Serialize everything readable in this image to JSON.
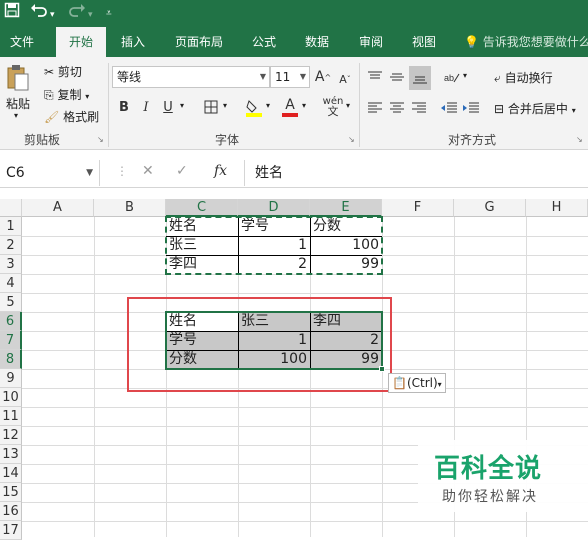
{
  "quick_access": {
    "save_icon": "save-icon",
    "undo_icon": "undo-icon",
    "redo_icon": "redo-icon",
    "customize_icon": "customize-icon"
  },
  "tabs": [
    "文件",
    "开始",
    "插入",
    "页面布局",
    "公式",
    "数据",
    "审阅",
    "视图"
  ],
  "active_tab": "开始",
  "tell_me": "告诉我您想要做什么",
  "ribbon": {
    "clipboard": {
      "paste": "粘贴",
      "cut": "剪切",
      "copy": "复制",
      "format_painter": "格式刷",
      "label": "剪贴板"
    },
    "font": {
      "name": "等线",
      "size": "11",
      "bold": "B",
      "italic": "I",
      "underline": "U",
      "label": "字体"
    },
    "alignment": {
      "wrap_text": "自动换行",
      "merge_center": "合并后居中",
      "label": "对齐方式"
    }
  },
  "formula_bar": {
    "name_box": "C6",
    "fx": "fx",
    "content": "姓名"
  },
  "columns": [
    "A",
    "B",
    "C",
    "D",
    "E",
    "F",
    "G",
    "H"
  ],
  "rows": [
    "1",
    "2",
    "3",
    "4",
    "5",
    "6",
    "7",
    "8",
    "9",
    "10",
    "11",
    "12",
    "13",
    "14",
    "15",
    "16",
    "17"
  ],
  "selected_columns": [
    "C",
    "D",
    "E"
  ],
  "selected_rows": [
    "6",
    "7",
    "8"
  ],
  "source_table": {
    "headers": [
      "姓名",
      "学号",
      "分数"
    ],
    "rows": [
      [
        "张三",
        "1",
        "100"
      ],
      [
        "李四",
        "2",
        "99"
      ]
    ]
  },
  "transposed_table": {
    "rows": [
      [
        "姓名",
        "张三",
        "李四"
      ],
      [
        "学号",
        "1",
        "2"
      ],
      [
        "分数",
        "100",
        "99"
      ]
    ]
  },
  "paste_options": "(Ctrl)",
  "watermark": {
    "title": "百科全说",
    "subtitle": "助你轻松解决"
  },
  "colors": {
    "excel_green": "#217346",
    "highlight_red": "#e0474c",
    "watermark_green": "#1aa36b"
  }
}
